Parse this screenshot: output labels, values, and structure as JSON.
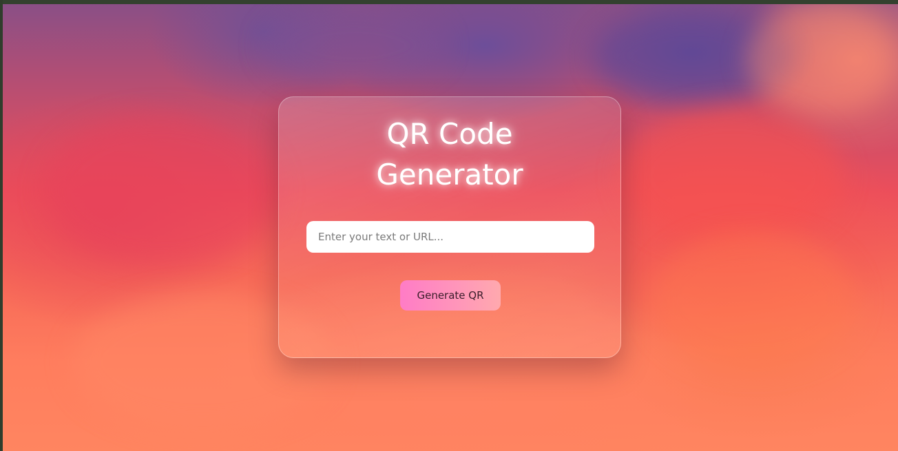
{
  "app": {
    "title_line1": "QR Code",
    "title_line2": "Generator"
  },
  "form": {
    "input_value": "",
    "input_placeholder": "Enter your text or URL...",
    "button_label": "Generate QR"
  },
  "colors": {
    "button_gradient_start": "#ff7cc6",
    "button_gradient_end": "#ffa9ae",
    "title_text": "#ffffff",
    "background_top": "#8a4f86",
    "background_bottom": "#ff8560"
  }
}
